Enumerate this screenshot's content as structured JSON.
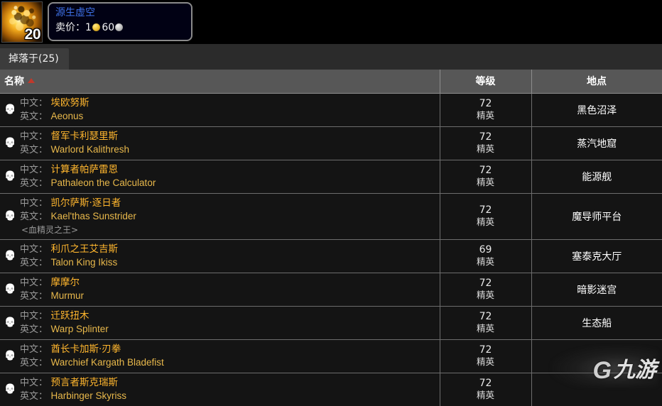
{
  "item": {
    "icon_name": "void-crystal-orb-icon",
    "stack_count": "20",
    "tooltip": {
      "title": "源生虚空",
      "title_color": "#3f72e8",
      "price_label": "卖价：",
      "gold": "1",
      "silver": "60",
      "gold_coin_name": "gold-coin-icon",
      "silver_coin_name": "silver-coin-icon"
    }
  },
  "tabs": [
    {
      "label": "掉落于(25)",
      "active": true
    }
  ],
  "table": {
    "headers": {
      "name": "名称",
      "level": "等级",
      "place": "地点"
    },
    "sort": {
      "column": "name",
      "direction": "asc",
      "indicator_color": "#c0392b"
    },
    "labels": {
      "cn": "中文：",
      "en": "英文："
    },
    "rows": [
      {
        "icon": "skull-icon",
        "name_cn": "埃欧努斯",
        "name_en": "Aeonus",
        "subtitle": "",
        "level": "72",
        "elite": "精英",
        "place": "黑色沼泽"
      },
      {
        "icon": "skull-icon",
        "name_cn": "督军卡利瑟里斯",
        "name_en": "Warlord Kalithresh",
        "subtitle": "",
        "level": "72",
        "elite": "精英",
        "place": "蒸汽地窟"
      },
      {
        "icon": "skull-icon",
        "name_cn": "计算者帕萨雷恩",
        "name_en": "Pathaleon the Calculator",
        "subtitle": "",
        "level": "72",
        "elite": "精英",
        "place": "能源舰"
      },
      {
        "icon": "skull-icon",
        "name_cn": "凯尔萨斯·逐日者",
        "name_en": "Kael'thas Sunstrider",
        "subtitle": "<血精灵之王>",
        "level": "72",
        "elite": "精英",
        "place": "魔导师平台"
      },
      {
        "icon": "skull-icon",
        "name_cn": "利爪之王艾吉斯",
        "name_en": "Talon King Ikiss",
        "subtitle": "",
        "level": "69",
        "elite": "精英",
        "place": "塞泰克大厅"
      },
      {
        "icon": "skull-icon",
        "name_cn": "摩摩尔",
        "name_en": "Murmur",
        "subtitle": "",
        "level": "72",
        "elite": "精英",
        "place": "暗影迷宫"
      },
      {
        "icon": "skull-icon",
        "name_cn": "迁跃扭木",
        "name_en": "Warp Splinter",
        "subtitle": "",
        "level": "72",
        "elite": "精英",
        "place": "生态船"
      },
      {
        "icon": "skull-icon",
        "name_cn": "酋长卡加斯·刃拳",
        "name_en": "Warchief Kargath Bladefist",
        "subtitle": "",
        "level": "72",
        "elite": "精英",
        "place": ""
      },
      {
        "icon": "skull-icon",
        "name_cn": "预言者斯克瑞斯",
        "name_en": "Harbinger Skyriss",
        "subtitle": "",
        "level": "72",
        "elite": "精英",
        "place": ""
      }
    ]
  },
  "watermark": {
    "logo_mark": "G",
    "logo_text": "九游"
  }
}
